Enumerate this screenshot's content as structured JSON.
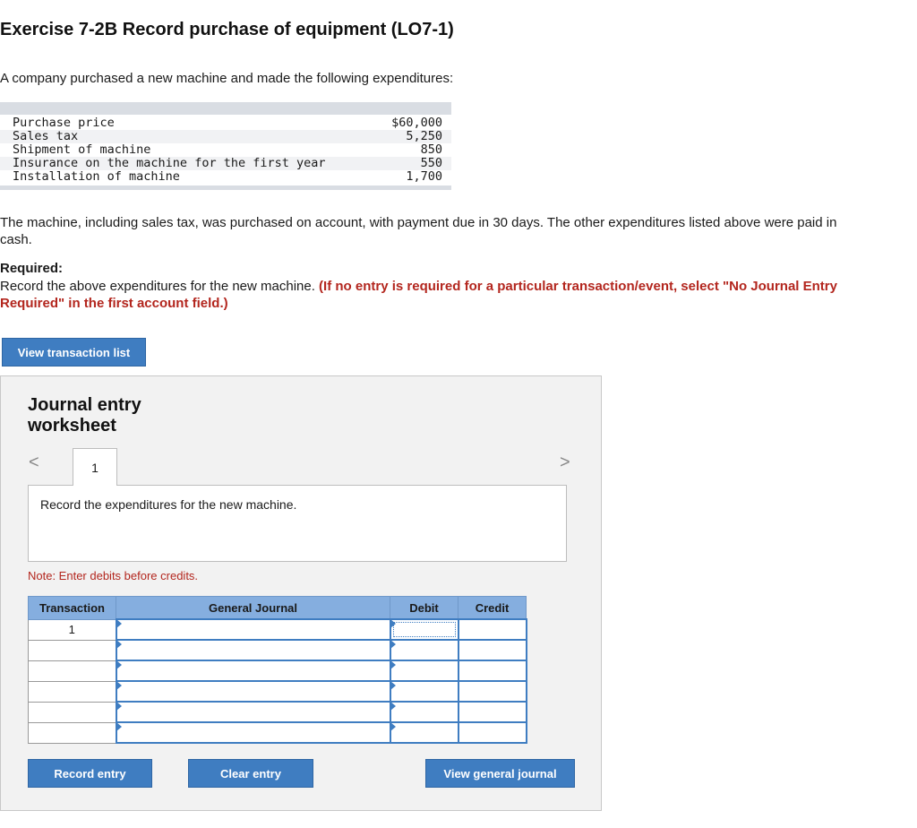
{
  "title": "Exercise 7-2B Record purchase of equipment (LO7-1)",
  "intro": "A company purchased a new machine and made the following expenditures:",
  "expenditures": [
    {
      "label": "Purchase price",
      "amount": "$60,000"
    },
    {
      "label": "Sales tax",
      "amount": "5,250"
    },
    {
      "label": "Shipment of machine",
      "amount": "850"
    },
    {
      "label": "Insurance on the machine for the first year",
      "amount": "550"
    },
    {
      "label": "Installation of machine",
      "amount": "1,700"
    }
  ],
  "paragraph": "The machine, including sales tax, was purchased on account, with payment due in 30 days. The other expenditures listed above were paid in cash.",
  "required_heading": "Required:",
  "required_text": "Record the above expenditures for the new machine. ",
  "required_note": "(If no entry is required for a particular transaction/event, select \"No Journal Entry Required\" in the first account field.)",
  "view_transaction_list": "View transaction list",
  "worksheet": {
    "title": "Journal entry worksheet",
    "prev_icon": "<",
    "next_icon": ">",
    "tab_label": "1",
    "prompt": "Record the expenditures for the new machine.",
    "note": "Note: Enter debits before credits.",
    "columns": [
      "Transaction",
      "General Journal",
      "Debit",
      "Credit"
    ],
    "rows": [
      {
        "transaction": "1",
        "account": "",
        "debit": "",
        "credit": ""
      },
      {
        "transaction": "",
        "account": "",
        "debit": "",
        "credit": ""
      },
      {
        "transaction": "",
        "account": "",
        "debit": "",
        "credit": ""
      },
      {
        "transaction": "",
        "account": "",
        "debit": "",
        "credit": ""
      },
      {
        "transaction": "",
        "account": "",
        "debit": "",
        "credit": ""
      },
      {
        "transaction": "",
        "account": "",
        "debit": "",
        "credit": ""
      }
    ],
    "record_entry": "Record entry",
    "clear_entry": "Clear entry",
    "view_general_journal": "View general journal"
  },
  "colors": {
    "accent": "#3f7dc1",
    "header": "#85aedf",
    "alert": "#b3261e"
  }
}
